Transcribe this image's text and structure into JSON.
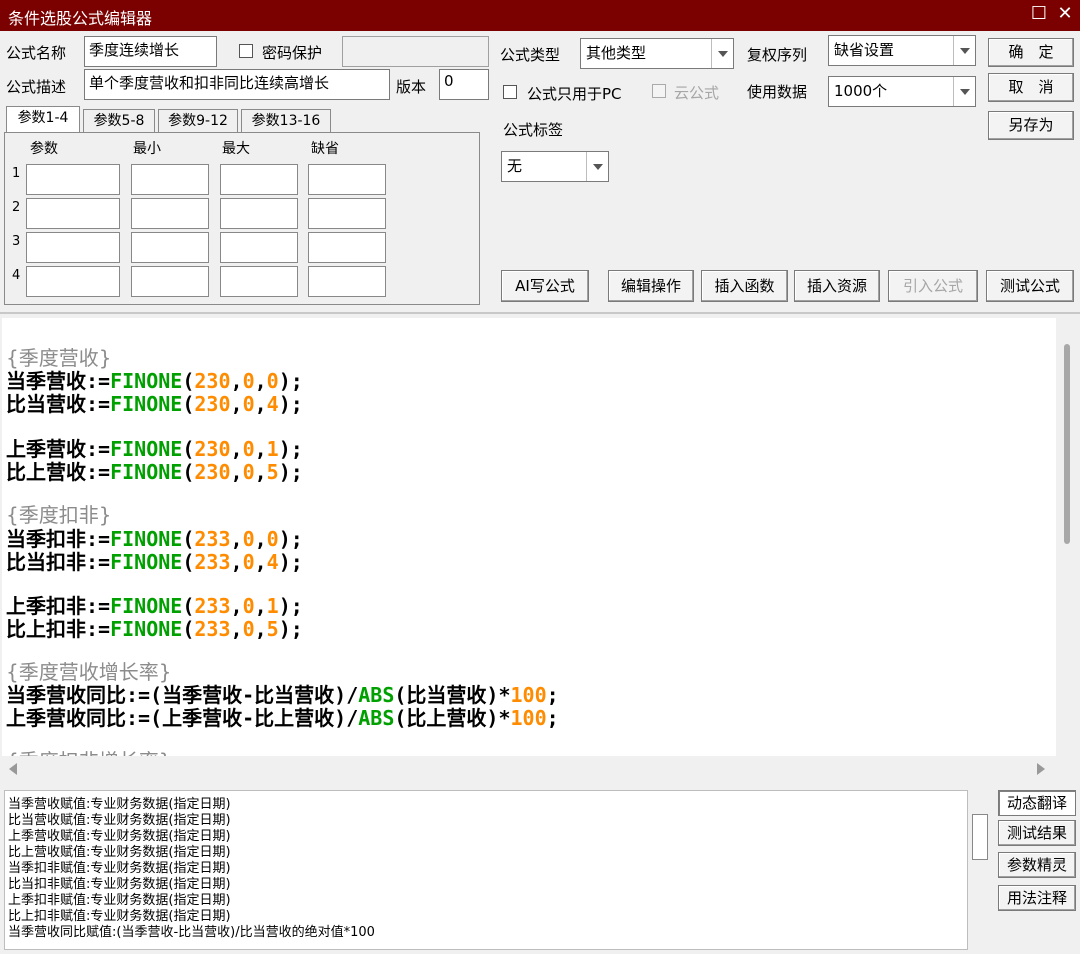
{
  "window": {
    "title": "条件选股公式编辑器",
    "maximize_glyph": "☐",
    "close_glyph": "✕"
  },
  "form": {
    "name_label": "公式名称",
    "name_value": "季度连续增长",
    "password_label": "密码保护",
    "desc_label": "公式描述",
    "desc_value": "单个季度营收和扣非同比连续高增长",
    "version_label": "版本",
    "version_value": "0",
    "type_label": "公式类型",
    "type_value": "其他类型",
    "pc_only_label": "公式只用于PC",
    "cloud_label": "云公式",
    "fq_label": "复权序列",
    "fq_value": "缺省设置",
    "data_label": "使用数据",
    "data_value": "1000个",
    "tag_label": "公式标签",
    "tag_value": "无"
  },
  "buttons": {
    "ok": "确　定",
    "cancel": "取　消",
    "save_as": "另存为"
  },
  "params": {
    "tabs": [
      "参数1-4",
      "参数5-8",
      "参数9-12",
      "参数13-16"
    ],
    "headers": [
      "参数",
      "最小",
      "最大",
      "缺省"
    ],
    "rows": [
      "1",
      "2",
      "3",
      "4"
    ]
  },
  "toolbar": [
    "AI写公式",
    "编辑操作",
    "插入函数",
    "插入资源",
    "引入公式",
    "测试公式"
  ],
  "code": {
    "c1": "{季度营收}",
    "l1a": "当季营收:=",
    "l1b": "(",
    "l1c": ");",
    "l2a": "比当营收:=",
    "l2c": ");",
    "l3a": "上季营收:=",
    "l3c": ");",
    "l4a": "比上营收:=",
    "l4c": ");",
    "c2": "{季度扣非}",
    "l5a": "当季扣非:=",
    "l6a": "比当扣非:=",
    "l7a": "上季扣非:=",
    "l8a": "比上扣非:=",
    "fn": "FINONE",
    "abs": "ABS",
    "n230": "230",
    "n233": "233",
    "n0": "0",
    "n1": "1",
    "n4": "4",
    "n5": "5",
    "n100": "100",
    "comma": ",",
    "c3": "{季度营收增长率}",
    "l9a": "当季营收同比:=(当季营收-比当营收)/",
    "l9b": "(比当营收)*",
    "semi": ";",
    "l10a": "上季营收同比:=(上季营收-比上营收)/",
    "l10b": "(比上营收)*",
    "c4": "{季度扣非增长率}"
  },
  "output_lines": [
    "当季营收赋值:专业财务数据(指定日期)",
    "比当营收赋值:专业财务数据(指定日期)",
    "上季营收赋值:专业财务数据(指定日期)",
    "比上营收赋值:专业财务数据(指定日期)",
    "当季扣非赋值:专业财务数据(指定日期)",
    "比当扣非赋值:专业财务数据(指定日期)",
    "上季扣非赋值:专业财务数据(指定日期)",
    "比上扣非赋值:专业财务数据(指定日期)",
    "当季营收同比赋值:(当季营收-比当营收)/比当营收的绝对值*100"
  ],
  "side_buttons": [
    "动态翻译",
    "测试结果",
    "参数精灵",
    "用法注释"
  ]
}
